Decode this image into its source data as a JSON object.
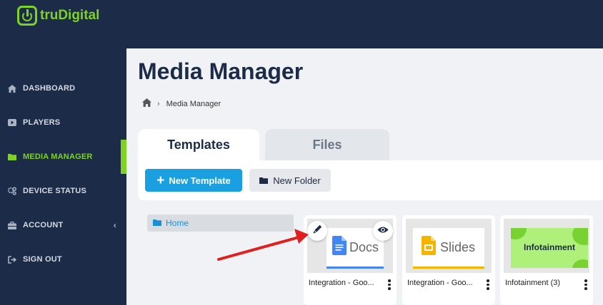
{
  "app": {
    "logo_text": "truDigital"
  },
  "sidebar": {
    "items": [
      {
        "label": "DASHBOARD",
        "icon": "home-icon"
      },
      {
        "label": "PLAYERS",
        "icon": "play-icon"
      },
      {
        "label": "MEDIA MANAGER",
        "icon": "folder-icon",
        "active": true
      },
      {
        "label": "DEVICE STATUS",
        "icon": "gears-icon"
      },
      {
        "label": "ACCOUNT",
        "icon": "briefcase-icon",
        "caret": "‹"
      },
      {
        "label": "SIGN OUT",
        "icon": "sign-out-icon"
      }
    ]
  },
  "main": {
    "title": "Media Manager",
    "breadcrumb": {
      "home_icon": "home-icon",
      "separator": "›",
      "current": "Media Manager"
    },
    "tabs": [
      {
        "label": "Templates",
        "active": true
      },
      {
        "label": "Files",
        "active": false
      }
    ],
    "toolbar": {
      "new_template": "New Template",
      "new_folder": "New Folder"
    },
    "tree": {
      "home": "Home"
    },
    "cards": [
      {
        "label": "Integration - Goo...",
        "thumb_text": "Docs",
        "thumb_type": "google-docs"
      },
      {
        "label": "Integration - Goo...",
        "thumb_text": "Slides",
        "thumb_type": "google-slides"
      },
      {
        "label": "Infotainment (3)",
        "thumb_text": "Infotainment",
        "thumb_type": "infotainment"
      }
    ]
  },
  "colors": {
    "sidebar_bg": "#1b2b48",
    "accent_green": "#7ed321",
    "primary_blue": "#1a9fe0",
    "annotation_red": "#e02020"
  }
}
